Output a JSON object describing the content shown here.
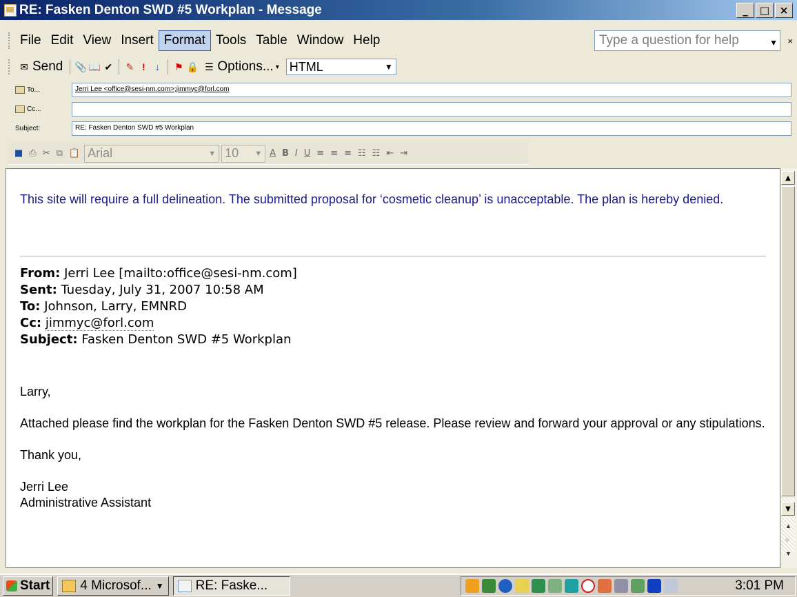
{
  "window": {
    "title": "RE: Fasken Denton SWD #5 Workplan - Message",
    "controls": [
      "_",
      "□",
      "×"
    ]
  },
  "menu": {
    "items": [
      "File",
      "Edit",
      "View",
      "Insert",
      "Format",
      "Tools",
      "Table",
      "Window",
      "Help"
    ],
    "active": "Format",
    "help_placeholder": "Type a question for help"
  },
  "toolbar": {
    "send_label": "Send",
    "options_label": "Options...",
    "format_value": "HTML"
  },
  "header": {
    "to_label": "To...",
    "to_value": "Jerri Lee <office@sesi-nm.com>;jimmyc@forl.com",
    "cc_label": "Cc...",
    "cc_value": "",
    "subject_label": "Subject:",
    "subject_value": "RE: Fasken Denton SWD #5 Workplan"
  },
  "formatting": {
    "font": "Arial",
    "size": "10"
  },
  "message": {
    "reply": "This site will require a full delineation. The submitted proposal for ‘cosmetic cleanup’ is unacceptable. The plan is hereby denied.",
    "from_label": "From:",
    "from_value": "Jerri Lee [mailto:office@sesi-nm.com]",
    "sent_label": "Sent:",
    "sent_value": "Tuesday, July 31, 2007 10:58 AM",
    "to_label": "To:",
    "to_value": "Johnson, Larry, EMNRD",
    "cc_label": "Cc:",
    "cc_value": "jimmyc@forl.com",
    "subject_label": "Subject:",
    "subject_value": "Fasken Denton SWD #5 Workplan",
    "greeting": "Larry,",
    "body": "Attached please find the workplan for the Fasken Denton SWD #5 release.  Please review and forward your approval or any stipulations.",
    "closing": "Thank you,",
    "signature_name": "Jerri Lee",
    "signature_title": "Administrative Assistant"
  },
  "taskbar": {
    "start_label": "Start",
    "group_label": "4 Microsof...",
    "active_task": "RE: Faske...",
    "clock": "3:01 PM"
  }
}
